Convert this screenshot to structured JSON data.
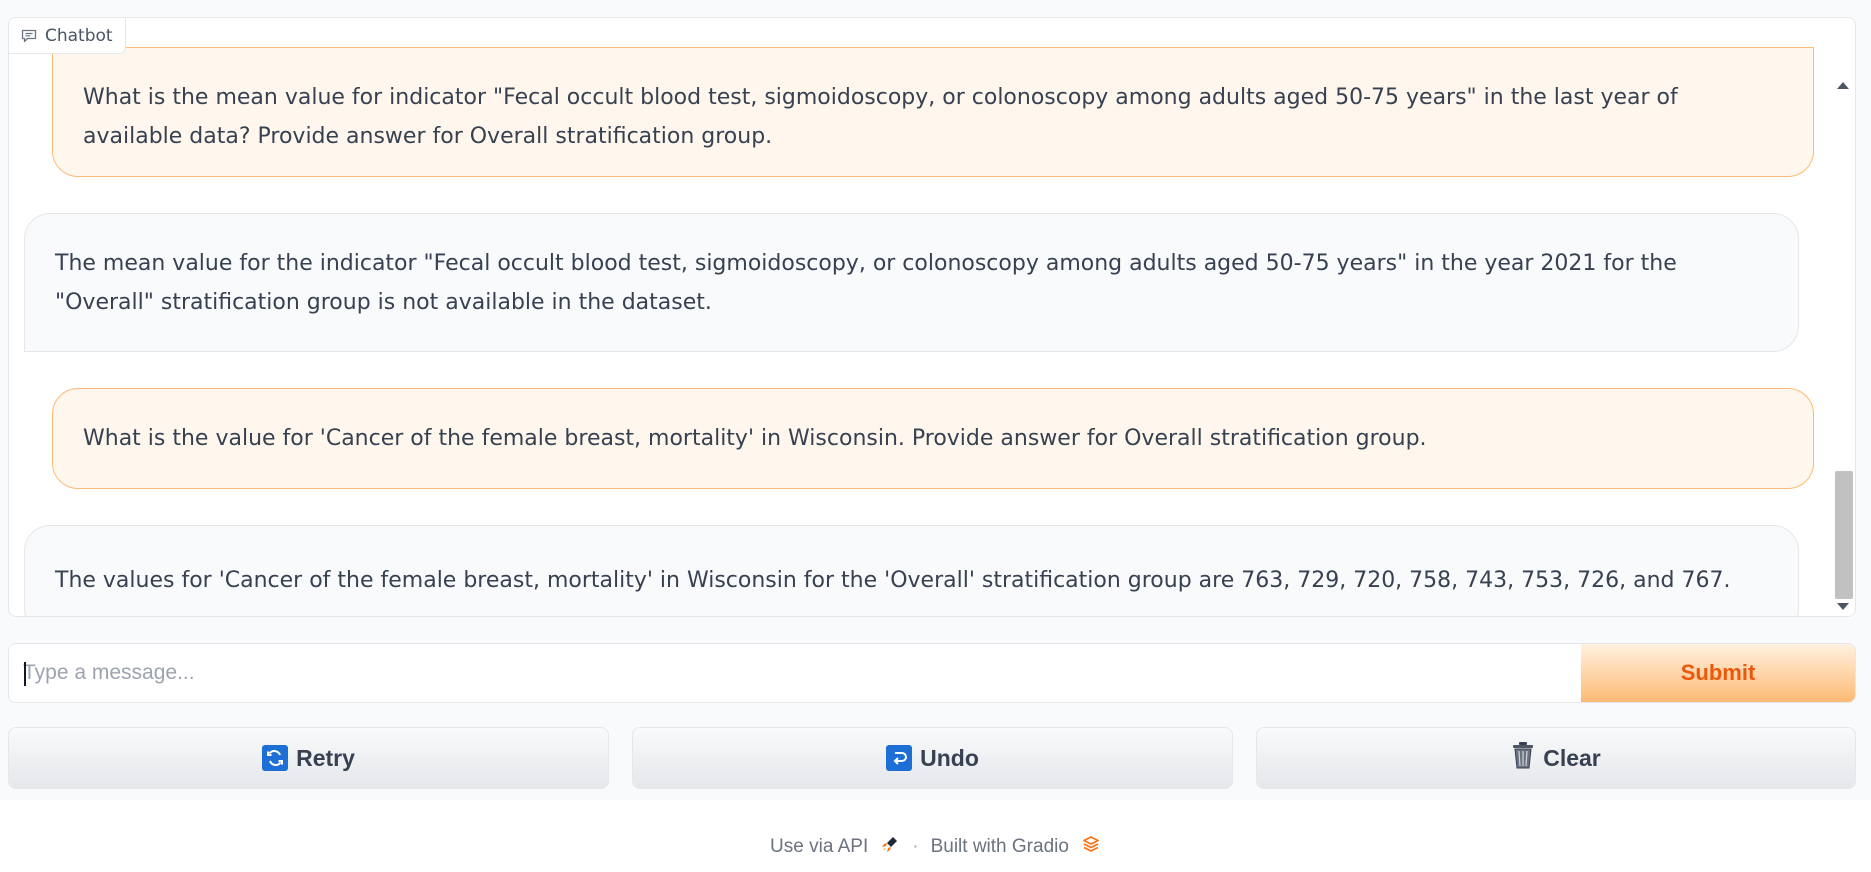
{
  "chatbot": {
    "label": "Chatbot",
    "messages": [
      {
        "role": "user",
        "text": "What is the mean value for indicator \"Fecal occult blood test, sigmoidoscopy, or colonoscopy among adults aged 50-75 years\" in the last year of available data? Provide answer for Overall stratification group."
      },
      {
        "role": "bot",
        "text": "The mean value for the indicator \"Fecal occult blood test, sigmoidoscopy, or colonoscopy among adults aged 50-75 years\" in the year 2021 for the \"Overall\" stratification group is not available in the dataset."
      },
      {
        "role": "user",
        "text": "What is the value for 'Cancer of the female breast, mortality' in Wisconsin. Provide answer for Overall stratification group."
      },
      {
        "role": "bot",
        "text": "The values for 'Cancer of the female breast, mortality' in Wisconsin for the 'Overall' stratification group are 763, 729, 720, 758, 743, 753, 726, and 767."
      }
    ]
  },
  "input": {
    "placeholder": "Type a message...",
    "value": ""
  },
  "buttons": {
    "submit": "Submit",
    "retry": "Retry",
    "undo": "Undo",
    "clear": "Clear"
  },
  "footer": {
    "api": "Use via API",
    "separator": "·",
    "built": "Built with Gradio"
  },
  "colors": {
    "accent": "#ea580c",
    "user_bubble": "#fff7ed",
    "user_border": "#fdba74",
    "bot_bubble": "#f9fafb"
  }
}
